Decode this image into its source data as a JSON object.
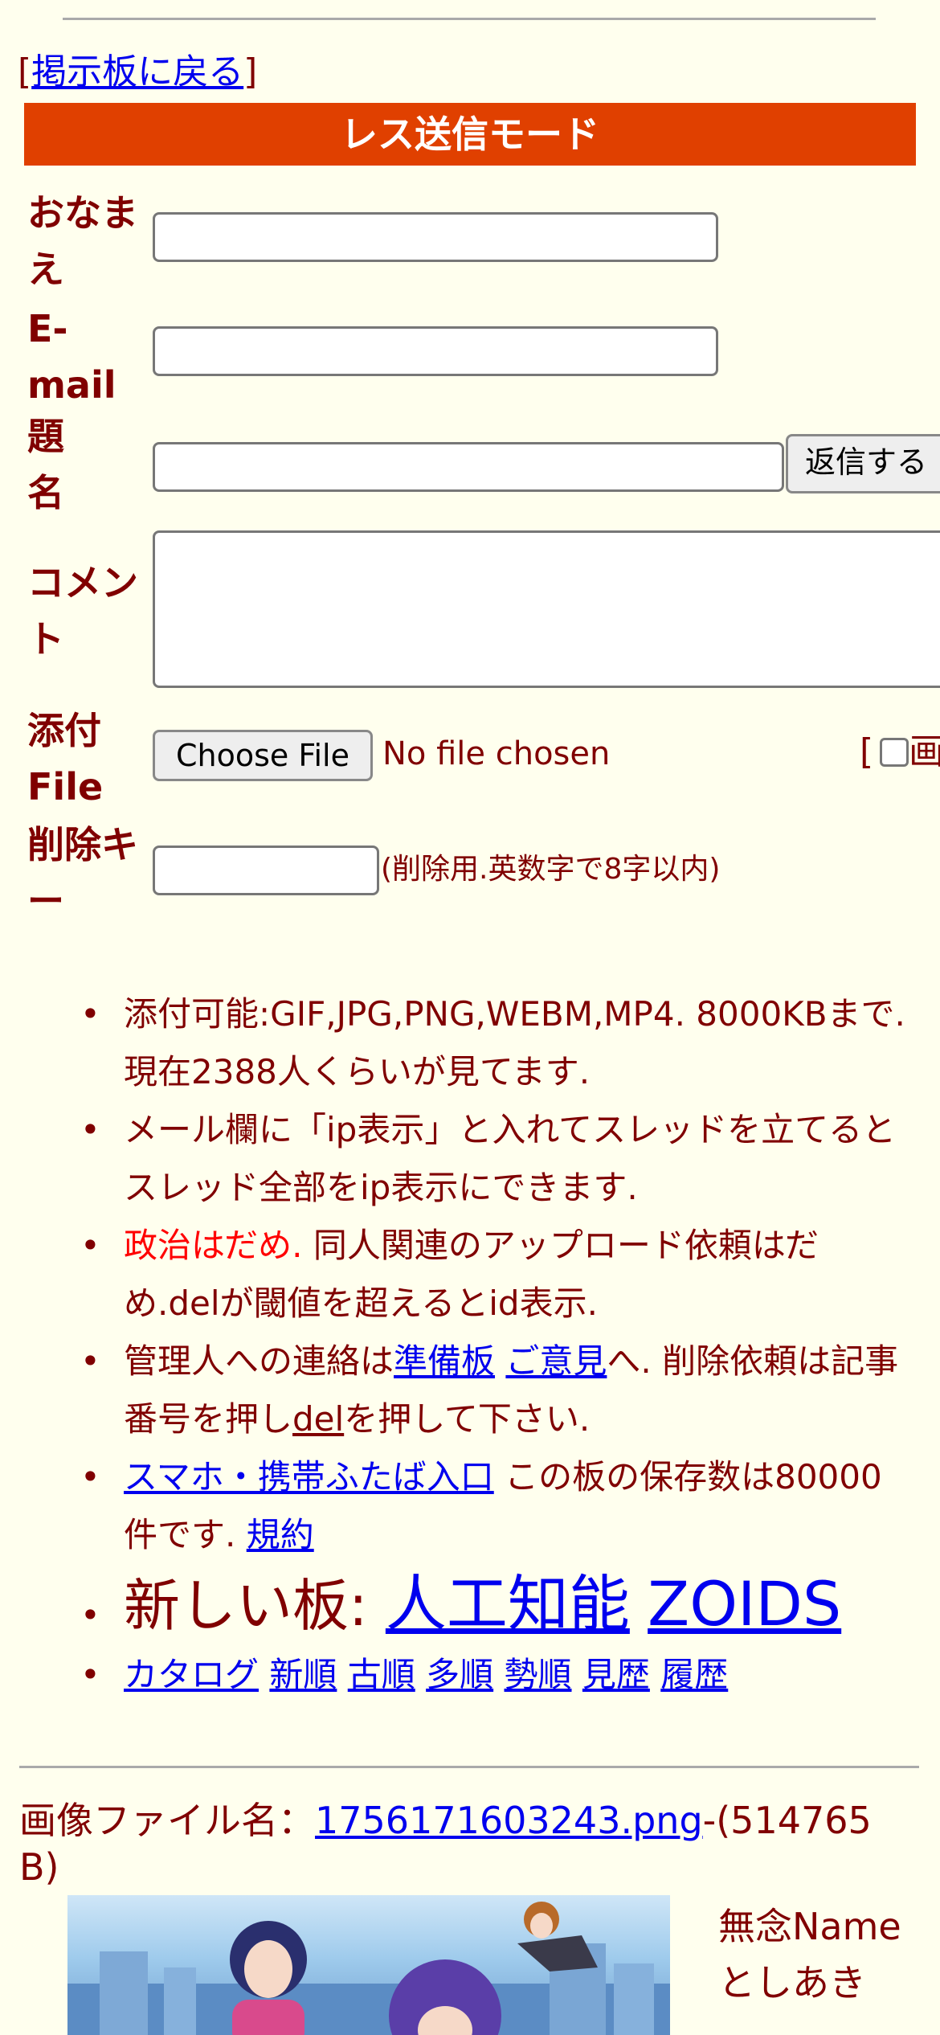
{
  "header": {
    "back_bracket_open": "[",
    "back_link": "掲示板に戻る",
    "back_bracket_close": "]",
    "mode_title": "レス送信モード"
  },
  "form": {
    "name_label": "おなまえ",
    "email_label": "E-mail",
    "subject_label": "題名",
    "submit_button": "返信する",
    "comment_label": "コメント",
    "file_label": "添付File",
    "choose_file_button": "Choose File",
    "file_status": "No file chosen",
    "attach_option_bracket": "[",
    "attach_option_label": "画",
    "delete_key_label": "削除キー",
    "delete_key_note": "(削除用.英数字で8字以内)"
  },
  "notes": {
    "n1": "添付可能:GIF,JPG,PNG,WEBM,MP4. 8000KBまで. 現在2388人くらいが見てます.",
    "n2": "メール欄に「ip表示」と入れてスレッドを立てるとスレッド全部をip表示にできます.",
    "n3_red": "政治はだめ.",
    "n3_rest": " 同人関連のアップロード依頼はだめ.delが閾値を超えるとid表示.",
    "n4_a": "管理人への連絡は",
    "n4_link1": "準備板",
    "n4_link2": "ご意見",
    "n4_b": "へ. 削除依頼は記事番号を押し",
    "n4_del": "del",
    "n4_c": "を押して下さい.",
    "n5_link": "スマホ・携帯ふたば入口",
    "n5_text": " この板の保存数は80000件です.",
    "n5_terms": "規約",
    "n6_label": "新しい板:",
    "n6_link1": "人工知能",
    "n6_link2": "ZOIDS",
    "catalog": [
      "カタログ",
      "新順",
      "古順",
      "多順",
      "勢順",
      "見歴",
      "履歴"
    ]
  },
  "post": {
    "filename_label": "画像ファイル名：",
    "filename_link": "1756171603243.png",
    "filesize": "-(514765 B)",
    "name": "無念Name",
    "poster": "としあき"
  },
  "colors": {
    "background": "#ffffee",
    "text": "#800000",
    "mode_bar": "#e04000",
    "link": "#0000ee",
    "warning": "#ff0000"
  }
}
